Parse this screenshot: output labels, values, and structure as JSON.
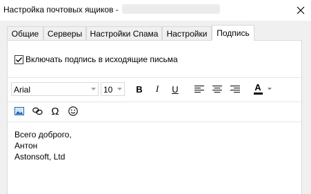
{
  "window": {
    "title": "Настройка почтовых ящиков -",
    "close_icon": "close-icon"
  },
  "tabs": [
    {
      "label": "Общие",
      "active": false
    },
    {
      "label": "Серверы",
      "active": false
    },
    {
      "label": "Настройки Спама",
      "active": false
    },
    {
      "label": "Настройки",
      "active": false
    },
    {
      "label": "Подпись",
      "active": true
    }
  ],
  "signature": {
    "enable_label": "Включать подпись в исходящие письма",
    "enabled": true
  },
  "formatting": {
    "font_family": "Arial",
    "font_size": "10",
    "bold": "B",
    "italic": "I",
    "underline": "U",
    "font_color_letter": "A",
    "font_color": "#000000",
    "icons": [
      "bold-icon",
      "italic-icon",
      "underline-icon",
      "align-left-icon",
      "align-center-icon",
      "align-right-icon",
      "font-color-icon",
      "dropdown-arrow-icon"
    ]
  },
  "insert": {
    "icons": [
      "insert-image-icon",
      "insert-link-icon",
      "insert-symbol-icon",
      "insert-emoji-icon"
    ],
    "symbol_glyph": "Ω"
  },
  "editor": {
    "lines": [
      "Всего доброго,",
      "Антон",
      "Astonsoft, Ltd"
    ]
  }
}
